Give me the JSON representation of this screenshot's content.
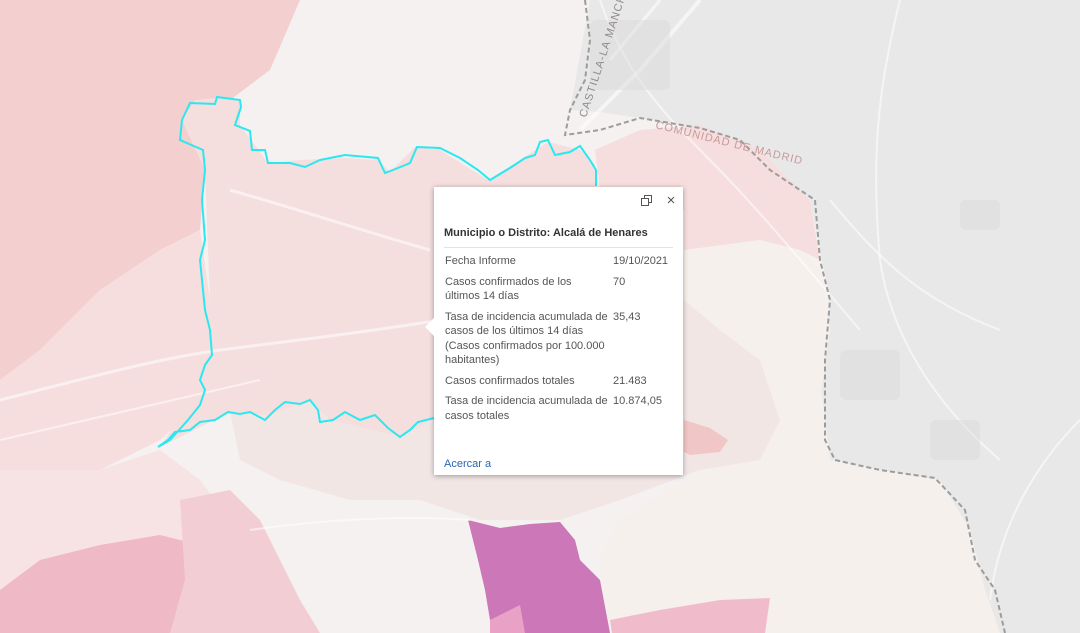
{
  "map": {
    "labels": {
      "region_castilla": "CASTILLA-LA MANCHA",
      "region_madrid": "COMUNIDAD DE MADRID"
    },
    "colors": {
      "background": "#f3f0ef",
      "selected_outline": "#2be8f0",
      "high_incidence": "#cc77b7",
      "medium_incidence": "#f0bfc7",
      "low_incidence": "#f5dcdc"
    }
  },
  "popup": {
    "title": "Municipio o Distrito: Alcalá de Henares",
    "dock_icon": "dock-icon",
    "close_icon": "close-icon",
    "close_label": "×",
    "fields": [
      {
        "label": "Fecha Informe",
        "value": "19/10/2021"
      },
      {
        "label": "Casos confirmados de los últimos 14 días",
        "value": "70"
      },
      {
        "label": "Tasa de incidencia acumulada de casos de los últimos 14 días (Casos confirmados por 100.000 habitantes)",
        "value": "35,43"
      },
      {
        "label": "Casos confirmados totales",
        "value": "21.483"
      },
      {
        "label": "Tasa de incidencia acumulada de casos totales",
        "value": "10.874,05"
      }
    ],
    "zoom_link": "Acercar a"
  }
}
